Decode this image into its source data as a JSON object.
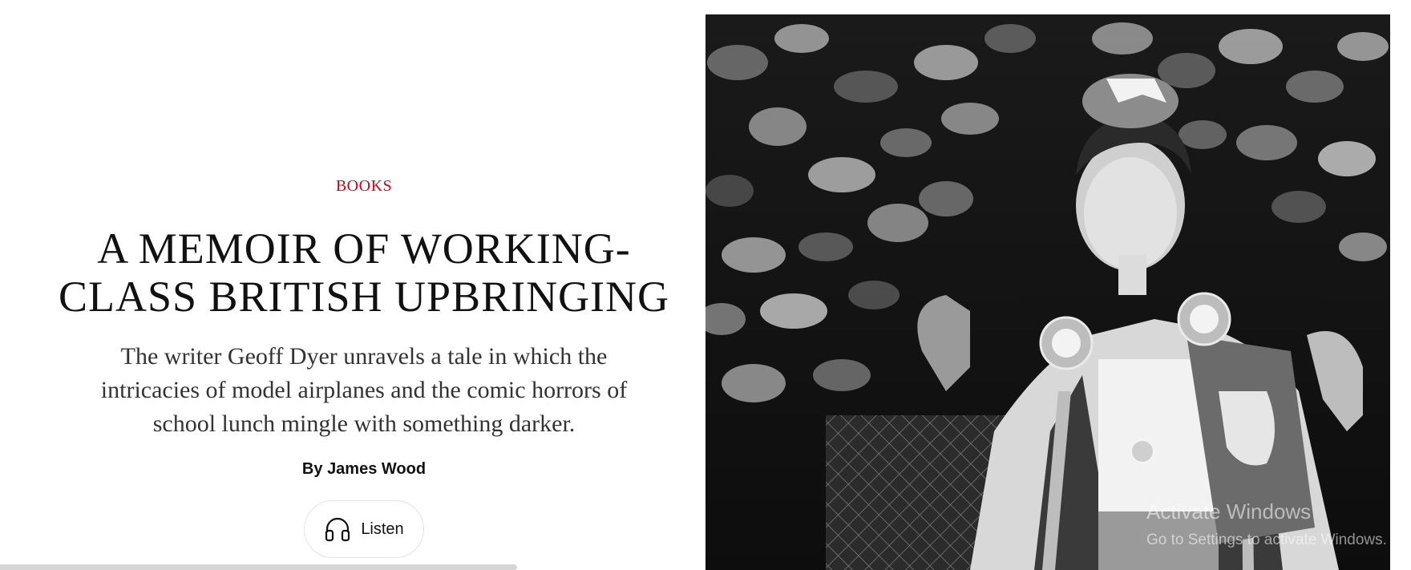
{
  "article": {
    "rubric": "BOOKS",
    "headline_line1": "A MEMOIR OF WORKING-",
    "headline_line2": "CLASS BRITISH UPBRINGING",
    "dek_line1": "The writer Geoff Dyer unravels a tale in which the",
    "dek_line2": "intricacies of model airplanes and the comic horrors of",
    "dek_line3": "school lunch mingle with something darker.",
    "byline_prefix": "By",
    "byline_name": "James Wood",
    "listen_label": "Listen"
  },
  "icons": {
    "listen": "headphones-icon"
  },
  "colors": {
    "rubric": "#d0021b",
    "text": "#111111",
    "dek": "#333333"
  },
  "system_overlay": {
    "title": "Activate Windows",
    "subtitle": "Go to Settings to activate Windows."
  }
}
